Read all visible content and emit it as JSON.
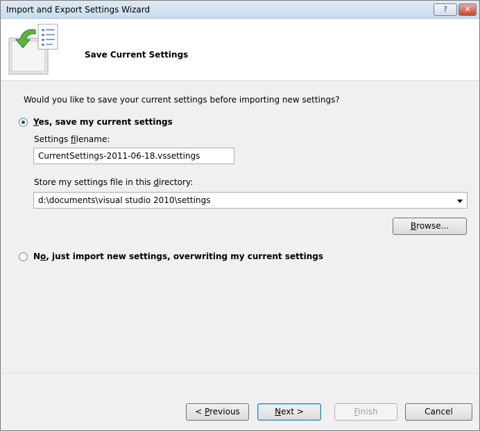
{
  "window": {
    "title": "Import and Export Settings Wizard",
    "help_label": "?",
    "close_label": "✕"
  },
  "header": {
    "heading": "Save Current Settings",
    "icon": "wizard-settings-icon"
  },
  "content": {
    "question": "Would you like to save your current settings before importing new settings?",
    "option_yes": {
      "prefix": "",
      "accel": "Y",
      "rest": "es, save my current settings",
      "selected": true
    },
    "filename_label": {
      "pre": "Settings ",
      "accel": "f",
      "post": "ilename:"
    },
    "filename_value": "CurrentSettings-2011-06-18.vssettings",
    "directory_label": {
      "pre": "Store my settings file in this ",
      "accel": "d",
      "post": "irectory:"
    },
    "directory_value": "d:\\documents\\visual studio 2010\\settings",
    "browse_button": {
      "accel": "B",
      "rest": "rowse..."
    },
    "option_no": {
      "pre": "N",
      "accel": "o",
      "rest": ", just import new settings, overwriting my current settings",
      "selected": false
    }
  },
  "footer": {
    "previous": {
      "pre": "< ",
      "accel": "P",
      "rest": "revious"
    },
    "next": {
      "accel": "N",
      "rest": "ext >"
    },
    "finish": {
      "accel": "F",
      "rest": "inish",
      "enabled": false
    },
    "cancel": "Cancel"
  }
}
